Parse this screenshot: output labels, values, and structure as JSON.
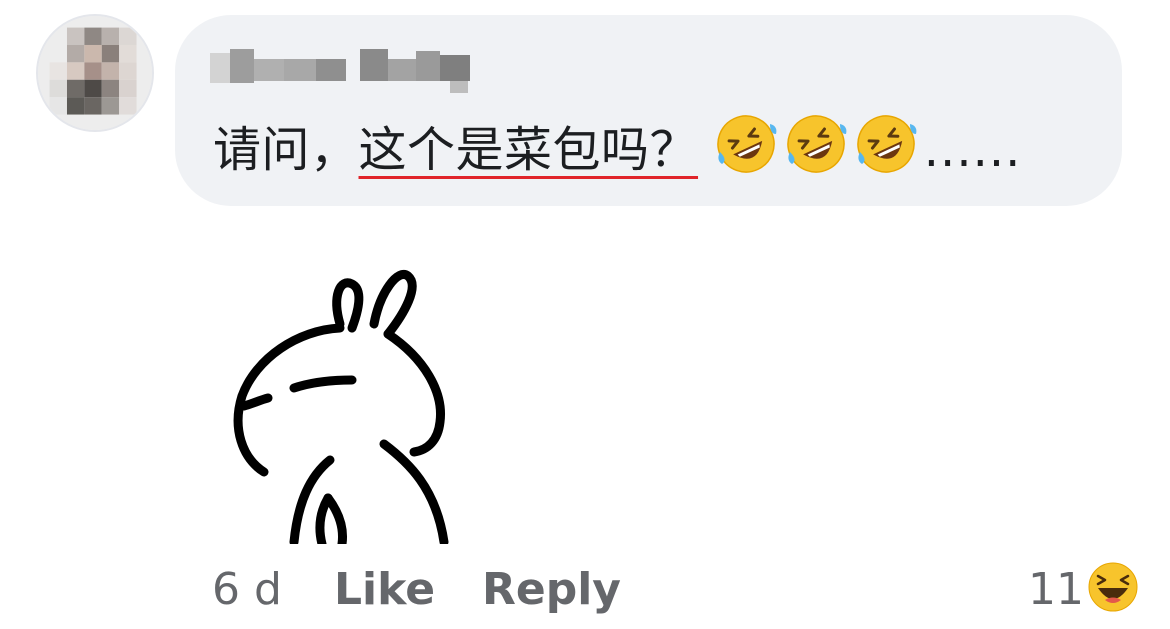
{
  "comment": {
    "author_blurred": true,
    "text_before": "请问，",
    "text_underlined": "这个是菜包吗？",
    "emojis": [
      "rolling-on-floor-laughing-emoji",
      "rolling-on-floor-laughing-emoji",
      "rolling-on-floor-laughing-emoji"
    ],
    "text_after": "......"
  },
  "sticker": {
    "icon": "rabbit-sticker"
  },
  "footer": {
    "time": "6 d",
    "like_label": "Like",
    "reply_label": "Reply",
    "reaction_count": "11",
    "reaction_icon": "laughing-reaction-emoji"
  },
  "colors": {
    "bubble": "#f0f2f5",
    "text": "#1c1e21",
    "meta": "#65676b",
    "underline": "#e0242a",
    "emoji": "#f7c42c"
  }
}
